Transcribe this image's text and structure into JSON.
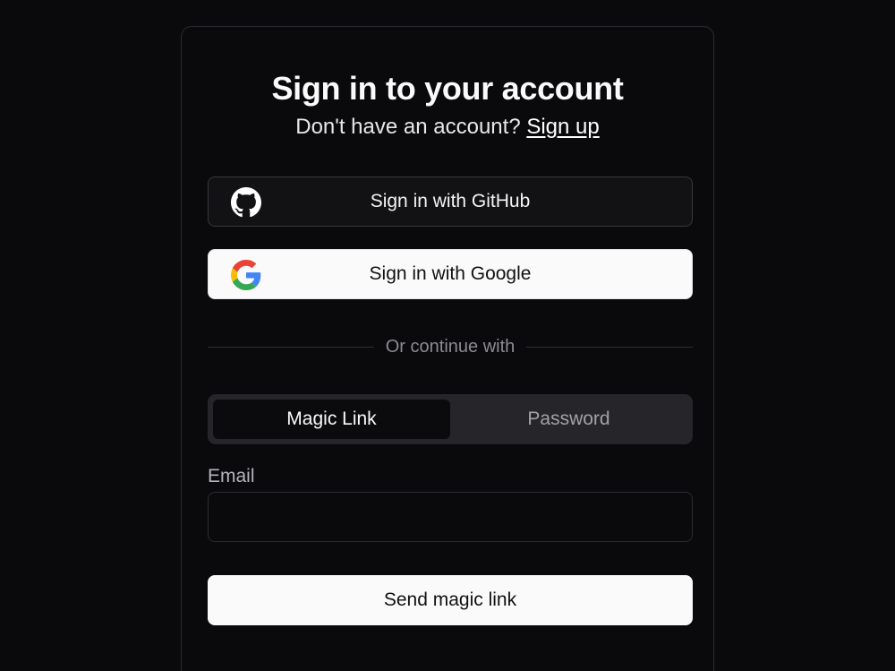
{
  "header": {
    "title": "Sign in to your account",
    "subtitle_prefix": "Don't have an account?",
    "signup_link": "Sign up"
  },
  "oauth": {
    "github": {
      "label": "Sign in with GitHub",
      "icon": "github-icon"
    },
    "google": {
      "label": "Sign in with Google",
      "icon": "google-icon"
    }
  },
  "divider": {
    "label": "Or continue with"
  },
  "tabs": [
    {
      "label": "Magic Link",
      "active": true
    },
    {
      "label": "Password",
      "active": false
    }
  ],
  "form": {
    "email_label": "Email",
    "email_value": "",
    "submit_label": "Send magic link"
  },
  "colors": {
    "background": "#0a0a0c",
    "card_border": "#2c2c30",
    "primary_button": "#fafafa",
    "tabs_track": "#26262a"
  }
}
